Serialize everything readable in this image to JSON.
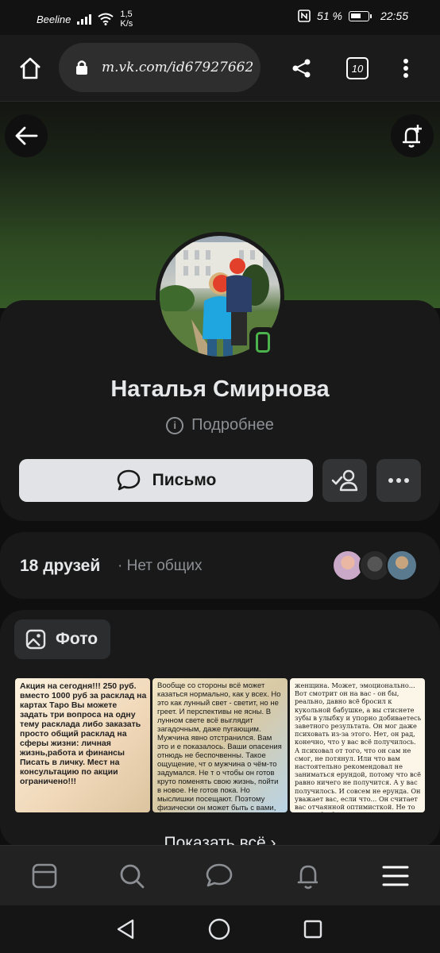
{
  "status_bar": {
    "carrier": "Beeline",
    "speed_value": "1,5",
    "speed_unit": "K/s",
    "battery_percent": "51 %",
    "time": "22:55"
  },
  "browser": {
    "url": "m.vk.com/id67927662",
    "tab_count": "10"
  },
  "profile": {
    "name": "Наталья Смирнова",
    "details_link": "Подробнее",
    "message_button": "Письмо"
  },
  "friends": {
    "count_label": "18 друзей",
    "mutual_label": "· Нет общих"
  },
  "photos": {
    "tab_label": "Фото",
    "show_all": "Показать всё",
    "items": [
      {
        "text": "Акция на сегодня!!! 250 руб. вместо 1000 руб за расклад на картах Таро Вы можете задать три вопроса на одну тему расклада либо заказать просто общий расклад на сферы жизни: личная жизнь,работа и финансы Писать в личку. Мест на консультацию по акции ограничено!!!"
      },
      {
        "text": "Вообще со стороны всё может казаться нормально, как у всех. Но это как лунный свет - светит, но не греет. И перспективы не ясны. В лунном свете всё выглядит загадочным, даже пугающим. Мужчина явно отстранился. Вам это и е показалось. Ваши опасения отнюдь не беспочвенны. Такое ощущение, чт о мужчина о чём-то задумался. Не т о чтобы он готов круто поменять свою жизнь, пойти в новое. Не готов пока. Но мыслишки посещают. Поэтому физически он может быть с вами, но душой уже далеко. Он решил разобраться в своих чувствах. Причём, нельзя на 100% заявить, что они изначально у него были, эти чувства. Нам показалось, что была страсть. Тяга на уровне тела. То есть мужчина вас желал, тянулся к вам. И эту тягу принимал за чувства. Кои сейчас стёл угасшими. Очевидно, что-то произошло с его тягой. Ослабела, что ли? Кто-то начал считать, что женщина стал а доминировать, диктовать свою волю. Стал"
      },
      {
        "text": "женщина. Может, эмоционально... Вот смотрит он на вас - он бы, реально, давно всё бросил к кукольной бабушке, а вы стиснете зубы в улыбку и упорно добиваетесь заветного результата. Он мог даже психовать из-за этого. Нет, он рад, конечно, что у вас всё получилось. А психовал от того, что он сам не смог, не потянул. Или что вам настоятельно рекомендовал не заниматься ерундой, потому что всё равно ничего не получится. А у вас получилось. И совсем не ерунда. Он уважает вас, если что... Он считает вас отчаянной оптимисткой. Не то что вы бы были притворно-улыбчивой. Просто дух ваш не сломить. Вы надеетесь на лучшее. Бывают моменты, когда у него нет сил даже смотреть телевизор, а вы порхаете, словно пёрышко. А когда не порхаете, то стараетесь это не демонстрировать. Потому он не всегда обращает внимание, что вы устали или приболели. Мог даже не заметить. Потому что вы всегда выполняете свою обычную работу. Сейчас многие их вас стоят перед неким рубежом. И кто-то пойдёт вперёд в совместное будущее, преодолев все сложности (и забыв всё плохое). А кто-то, к сожалению (или к счастью?) расстанется. Тут нет общего итога. Общее у всех вас - это черта, рубеж, развилка двух дорог. Но пойдут все по разным"
      }
    ]
  },
  "icons": {
    "home": "home-icon",
    "lock": "lock-icon",
    "share": "share-icon",
    "menu": "more-vertical-icon",
    "back": "arrow-left-icon",
    "subscribe": "bell-add-icon",
    "message": "chat-bubble-icon",
    "friend_status": "user-check-icon",
    "more": "more-horizontal-icon",
    "photo": "image-icon"
  },
  "colors": {
    "background": "#0f0f0f",
    "card": "#191919",
    "primary_button": "#e1e3e6",
    "online": "#4bb34b",
    "secondary_text": "#8d9094"
  }
}
